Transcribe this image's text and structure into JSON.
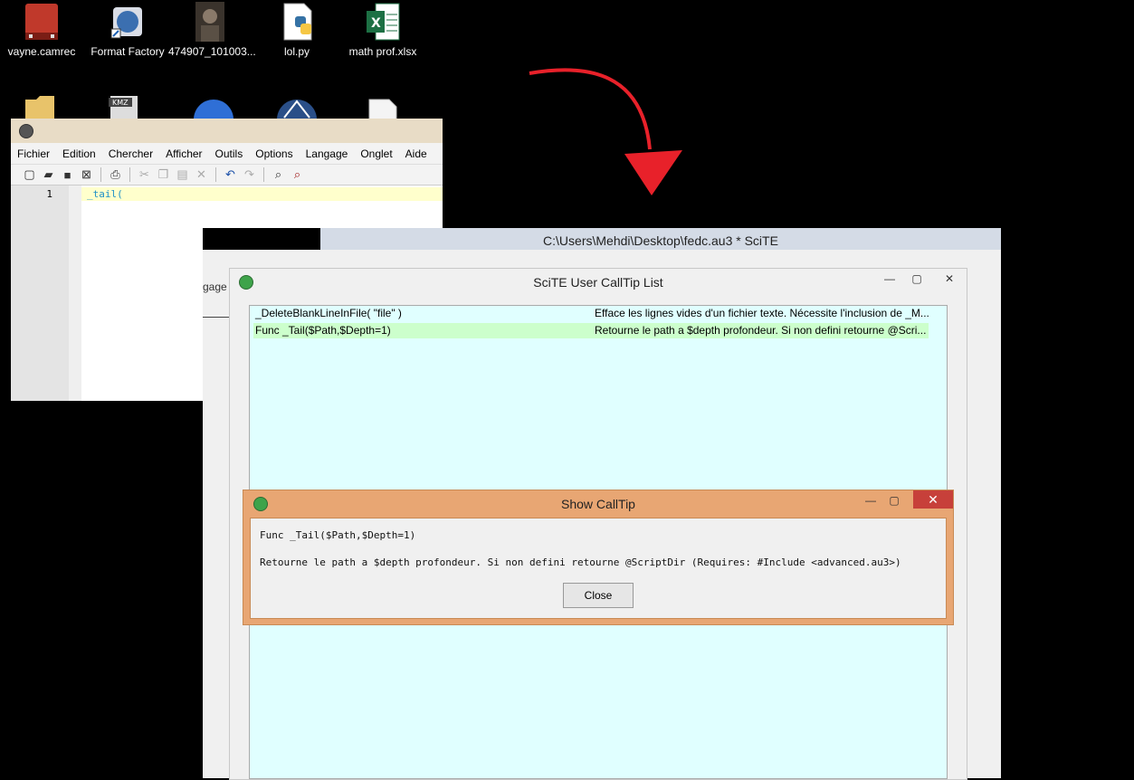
{
  "desktop_icons": [
    {
      "label": "vayne.camrec",
      "icon": "video-file-icon",
      "color": "#c0392b"
    },
    {
      "label": "Format Factory",
      "icon": "format-factory-icon",
      "color": "#3b6fb0"
    },
    {
      "label": "474907_101003...",
      "icon": "photo-file-icon",
      "color": "#5a5045"
    },
    {
      "label": "lol.py",
      "icon": "python-file-icon",
      "color": "#3572a5"
    },
    {
      "label": "math prof.xlsx",
      "icon": "excel-file-icon",
      "color": "#1d7044"
    }
  ],
  "editor": {
    "menu": [
      "Fichier",
      "Edition",
      "Chercher",
      "Afficher",
      "Outils",
      "Options",
      "Langage",
      "Onglet",
      "Aide"
    ],
    "line_number": "1",
    "code": "_tail("
  },
  "main_window": {
    "title": "C:\\Users\\Mehdi\\Desktop\\fedc.au3 * SciTE",
    "menu_fragment": "gage"
  },
  "calltip_list": {
    "title": "SciTE User CallTip List",
    "rows": [
      {
        "func": "_DeleteBlankLineInFile( \"file\" )",
        "desc": "Efface les lignes vides d'un fichier texte. Nécessite l'inclusion de _M..."
      },
      {
        "func": "Func _Tail($Path,$Depth=1)",
        "desc": "Retourne le path a $depth profondeur. Si non defini retourne @Scri..."
      }
    ]
  },
  "show_calltip": {
    "title": "Show CallTip",
    "signature": "Func _Tail($Path,$Depth=1)",
    "description": "Retourne le path a $depth profondeur. Si non defini retourne @ScriptDir (Requires: #Include <advanced.au3>)",
    "close_label": "Close"
  },
  "colors": {
    "arrow": "#e8212a",
    "dialog_frame": "#e8a673",
    "list_bg": "#e0ffff",
    "selected_row": "#ccffcc"
  }
}
